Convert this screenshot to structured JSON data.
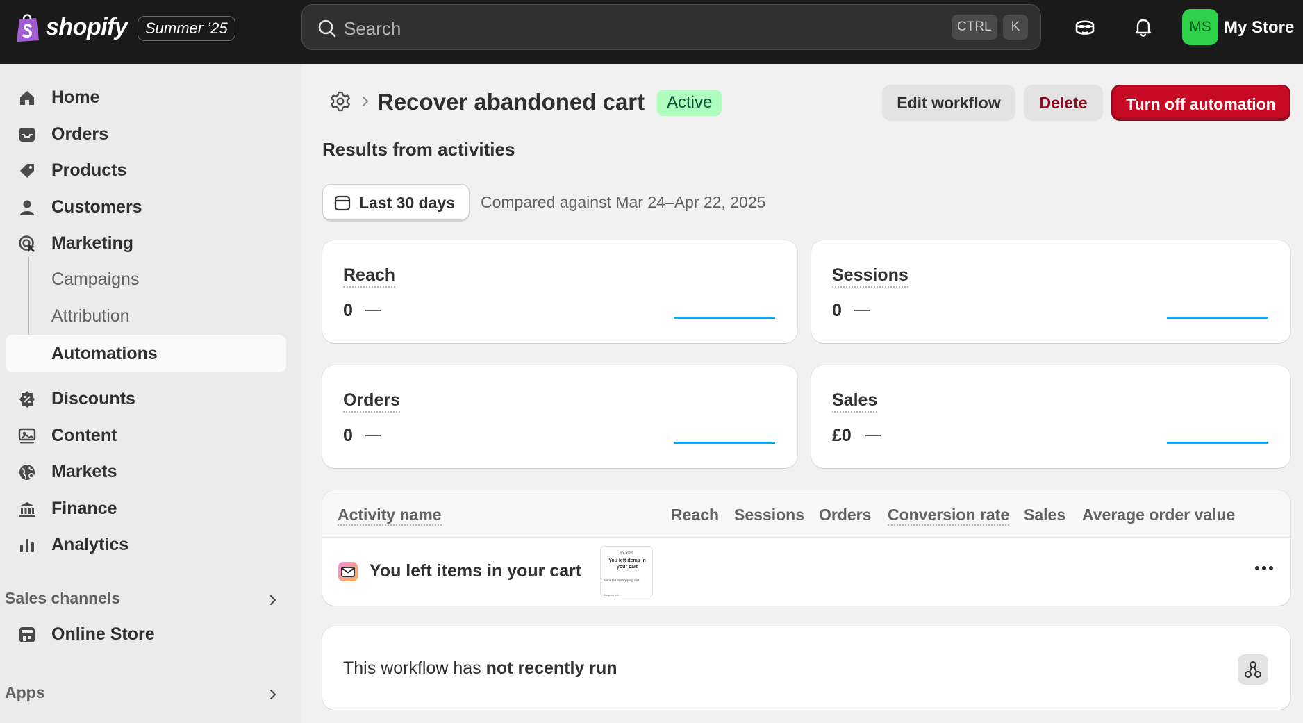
{
  "topbar": {
    "brand": "shopify",
    "edition": "Summer ’25",
    "search_placeholder": "Search",
    "shortcut_ctrl": "CTRL",
    "shortcut_k": "K",
    "avatar_initials": "MS",
    "store_name": "My Store",
    "icons": [
      "shopify-bag-icon",
      "search-icon",
      "sidekick-icon",
      "bell-icon"
    ]
  },
  "sidebar": {
    "items": [
      {
        "label": "Home",
        "icon": "home-icon"
      },
      {
        "label": "Orders",
        "icon": "inbox-icon"
      },
      {
        "label": "Products",
        "icon": "tag-icon"
      },
      {
        "label": "Customers",
        "icon": "person-icon"
      },
      {
        "label": "Marketing",
        "icon": "target-icon"
      },
      {
        "label": "Campaigns"
      },
      {
        "label": "Attribution"
      },
      {
        "label": "Automations"
      },
      {
        "label": "Discounts",
        "icon": "discount-icon"
      },
      {
        "label": "Content",
        "icon": "content-icon"
      },
      {
        "label": "Markets",
        "icon": "globe-icon"
      },
      {
        "label": "Finance",
        "icon": "bank-icon"
      },
      {
        "label": "Analytics",
        "icon": "bar-chart-icon"
      }
    ],
    "sales_channels_label": "Sales channels",
    "online_store_label": "Online Store",
    "apps_label": "Apps"
  },
  "page": {
    "title": "Recover abandoned cart",
    "status": "Active",
    "edit_label": "Edit workflow",
    "delete_label": "Delete",
    "turn_off_label": "Turn off automation",
    "results_heading": "Results from activities",
    "date_range": "Last 30 days",
    "compared_text": "Compared against Mar 24–Apr 22, 2025"
  },
  "metrics": [
    {
      "label": "Reach",
      "value": "0"
    },
    {
      "label": "Sessions",
      "value": "0"
    },
    {
      "label": "Orders",
      "value": "0"
    },
    {
      "label": "Sales",
      "value": "£0"
    }
  ],
  "table": {
    "headers": [
      "Activity name",
      "Reach",
      "Sessions",
      "Orders",
      "Conversion rate",
      "Sales",
      "Average order value"
    ],
    "rows": [
      {
        "name": "You left items in your cart",
        "thumb_store": "My Store",
        "thumb_title": "You left items in your cart",
        "thumb_line": "Items left in shopping cart",
        "thumb_foot": "Company Info"
      }
    ]
  },
  "status": {
    "prefix": "This workflow has ",
    "emphasis": "not recently run"
  },
  "colors": {
    "topbar": "#1a1a1a",
    "primary_danger": "#c70a24",
    "badge_success": "#affebf",
    "sparkline": "#17a3e8",
    "avatar": "#2dd24a"
  }
}
